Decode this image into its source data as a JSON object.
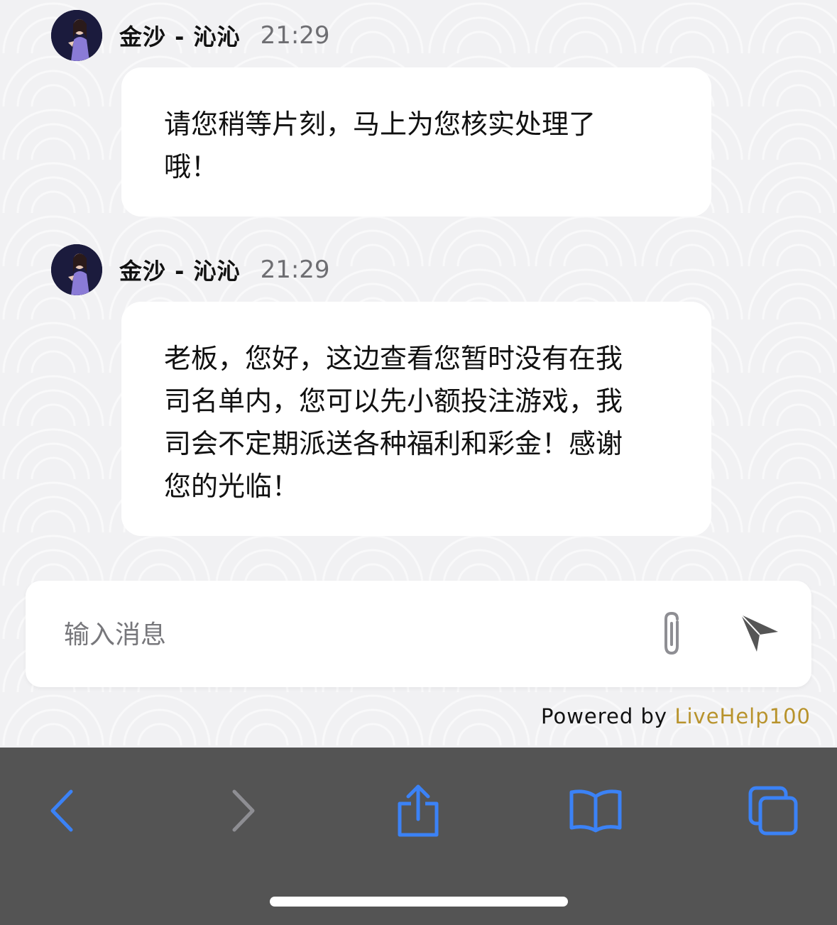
{
  "messages": [
    {
      "sender": "金沙 - 沁沁",
      "time": "21:29",
      "lines": [
        "请您稍等片刻，马上为您核实处理了",
        "哦！"
      ]
    },
    {
      "sender": "金沙 - 沁沁",
      "time": "21:29",
      "lines": [
        "老板，您好，这边查看您暂时没有在我",
        "司名单内，您可以先小额投注游戏，我",
        "司会不定期派送各种福利和彩金！感谢",
        "您的光临！"
      ]
    }
  ],
  "composer": {
    "placeholder": "输入消息",
    "attach_icon": "paperclip-icon",
    "send_icon": "paper-plane-icon"
  },
  "footer": {
    "powered_prefix": "Powered by",
    "powered_brand": "LiveHelp100",
    "brand_color": "#b8932c"
  },
  "browser_toolbar": {
    "icons": [
      "chevron-left-icon",
      "chevron-right-icon",
      "share-icon",
      "bookmarks-icon",
      "tabs-icon"
    ],
    "accent_color": "#3b82f6",
    "disabled_color": "#8e8e93"
  }
}
